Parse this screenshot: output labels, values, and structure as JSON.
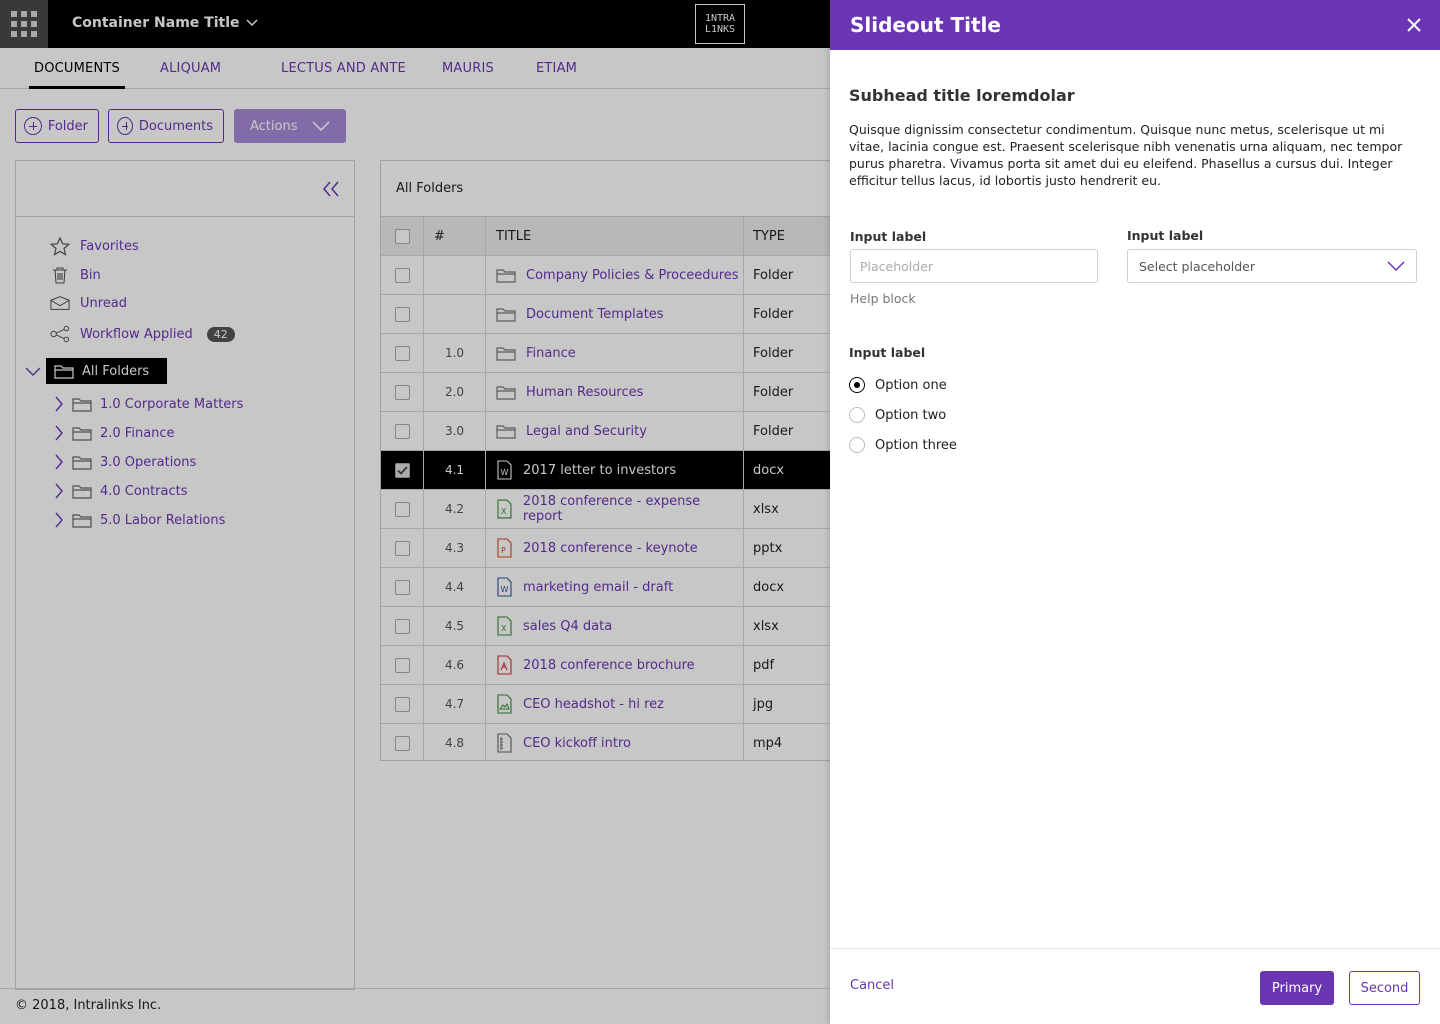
{
  "topbar": {
    "container_title": "Container Name Title",
    "logo_line1": "1NTRA",
    "logo_line2": "L1NKS"
  },
  "tabs": [
    {
      "label": "DOCUMENTS",
      "active": true
    },
    {
      "label": "ALIQUAM"
    },
    {
      "label": "LECTUS AND ANTE"
    },
    {
      "label": "MAURIS"
    },
    {
      "label": "ETIAM"
    }
  ],
  "toolbar": {
    "folder_label": "Folder",
    "documents_label": "Documents",
    "actions_label": "Actions"
  },
  "sidebar": {
    "items": [
      {
        "label": "Favorites",
        "icon": "star-icon"
      },
      {
        "label": "Bin",
        "icon": "trash-icon"
      },
      {
        "label": "Unread",
        "icon": "envelope-icon"
      },
      {
        "label": "Workflow Applied",
        "icon": "share-icon",
        "badge": "42"
      }
    ],
    "all_folders": "All Folders",
    "tree": [
      {
        "label": "1.0 Corporate Matters"
      },
      {
        "label": "2.0 Finance"
      },
      {
        "label": "3.0 Operations"
      },
      {
        "label": "4.0 Contracts"
      },
      {
        "label": "5.0 Labor Relations"
      }
    ]
  },
  "table": {
    "caption": "All Folders",
    "columns": {
      "num": "#",
      "title": "TITLE",
      "type": "TYPE"
    },
    "rows": [
      {
        "num": "",
        "title": "Company Policies & Proceedures",
        "type": "Folder",
        "icon": "folder-icon"
      },
      {
        "num": "",
        "title": "Document Templates",
        "type": "Folder",
        "icon": "folder-icon"
      },
      {
        "num": "1.0",
        "title": "Finance",
        "type": "Folder",
        "icon": "folder-icon"
      },
      {
        "num": "2.0",
        "title": "Human Resources",
        "type": "Folder",
        "icon": "folder-icon"
      },
      {
        "num": "3.0",
        "title": "Legal and Security",
        "type": "Folder",
        "icon": "folder-icon"
      },
      {
        "num": "4.1",
        "title": "2017 letter to investors",
        "type": "docx",
        "icon": "word-icon",
        "selected": true
      },
      {
        "num": "4.2",
        "title": "2018 conference - expense report",
        "type": "xlsx",
        "icon": "excel-icon"
      },
      {
        "num": "4.3",
        "title": "2018 conference - keynote",
        "type": "pptx",
        "icon": "powerpoint-icon"
      },
      {
        "num": "4.4",
        "title": "marketing email - draft",
        "type": "docx",
        "icon": "word-icon"
      },
      {
        "num": "4.5",
        "title": "sales Q4 data",
        "type": "xlsx",
        "icon": "excel-icon"
      },
      {
        "num": "4.6",
        "title": "2018 conference brochure",
        "type": "pdf",
        "icon": "pdf-icon"
      },
      {
        "num": "4.7",
        "title": "CEO headshot - hi rez",
        "type": "jpg",
        "icon": "image-icon"
      },
      {
        "num": "4.8",
        "title": "CEO kickoff intro",
        "type": "mp4",
        "icon": "video-icon"
      }
    ]
  },
  "footer": {
    "copyright": "© 2018, Intralinks Inc."
  },
  "slideout": {
    "title": "Slideout Title",
    "subhead": "Subhead title loremdolar",
    "body": "Quisque dignissim consectetur condimentum. Quisque nunc metus, scelerisque ut mi vitae, lacinia congue est. Praesent scelerisque nibh venenatis urna aliquam, nec tempor purus pharetra. Vivamus porta sit amet dui eu eleifend. Phasellus a cursus dui. Integer efficitur tellus lacus, id lobortis justo hendrerit eu.",
    "text_field": {
      "label": "Input label",
      "placeholder": "Placeholder",
      "help": "Help block"
    },
    "select_field": {
      "label": "Input label",
      "placeholder": "Select placeholder"
    },
    "radio_group": {
      "label": "Input label",
      "options": [
        {
          "label": "Option one",
          "checked": true
        },
        {
          "label": "Option two"
        },
        {
          "label": "Option three"
        }
      ]
    },
    "cancel_label": "Cancel",
    "primary_label": "Primary",
    "second_label": "Second"
  },
  "colors": {
    "accent": "#6b36b3",
    "topbar": "#000000",
    "selected_row": "#000000"
  }
}
